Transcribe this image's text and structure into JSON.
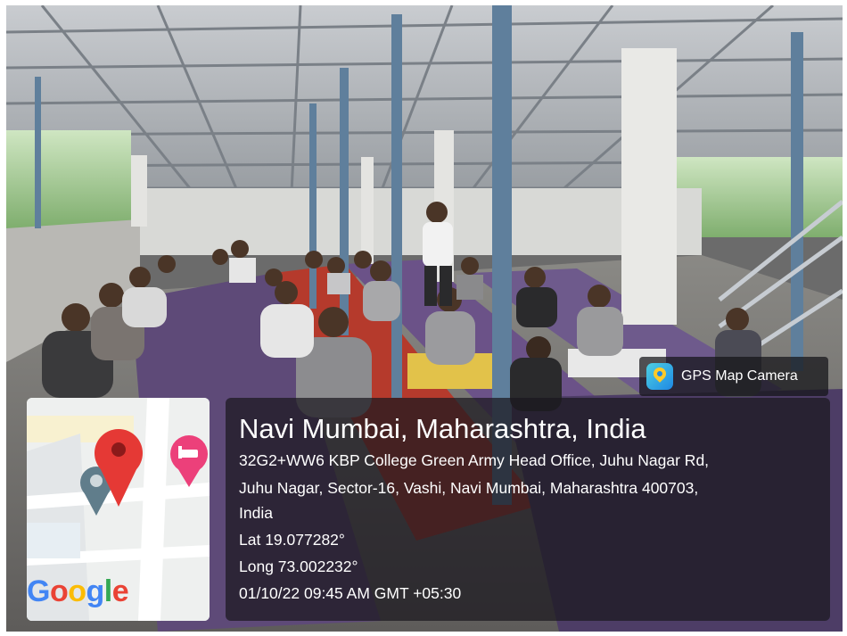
{
  "overlay": {
    "app_badge": "GPS Map Camera",
    "place_title": "Navi Mumbai, Maharashtra, India",
    "address_line_1": "32G2+WW6 KBP College Green Army Head Office, Juhu Nagar Rd,",
    "address_line_2": "Juhu Nagar, Sector-16, Vashi, Navi Mumbai, Maharashtra 400703,",
    "address_line_3": "India",
    "latitude": "Lat 19.077282°",
    "longitude": "Long 73.002232°",
    "datetime": "01/10/22 09:45 AM GMT +05:30"
  },
  "map": {
    "logo_text": "Google",
    "pin_color": "#e53935",
    "hotel_pin_color": "#ec407a",
    "icons": [
      "location-pin-icon",
      "hotel-pin-icon",
      "map-marker-icon"
    ]
  },
  "colors": {
    "roof_steel": "#9a9ea3",
    "pillar_blue": "#5f7f9c",
    "mat_purple": "#5e4a78",
    "mat_red": "#b53a2c",
    "floor_grey": "#7d7b78"
  }
}
